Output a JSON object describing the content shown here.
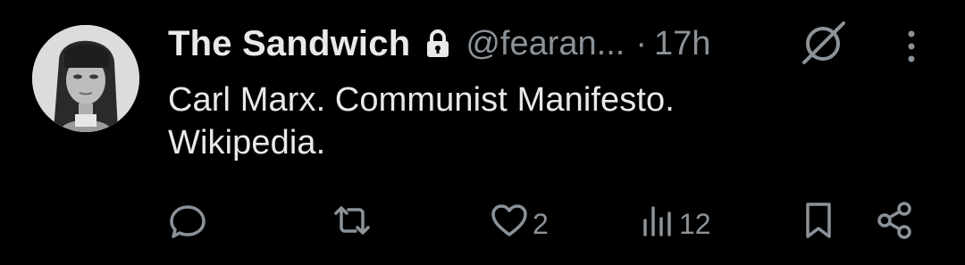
{
  "tweet": {
    "author_name": "The Sandwich",
    "handle": "@fearan...",
    "separator": "·",
    "time": "17h",
    "text_lines": [
      "Carl Marx. Communist Manifesto.",
      "Wikipedia."
    ],
    "likes_count": "2",
    "views_count": "12"
  },
  "icons": {
    "lock": "lock-icon",
    "grok": "grok-icon",
    "more": "more-vertical-icon",
    "reply": "reply-icon",
    "retweet": "retweet-icon",
    "like": "heart-icon",
    "views": "views-chart-icon",
    "bookmark": "bookmark-icon",
    "share": "share-icon"
  },
  "colors": {
    "background": "#000000",
    "primary_text": "#e7e9ea",
    "secondary_text": "#8b9298"
  }
}
